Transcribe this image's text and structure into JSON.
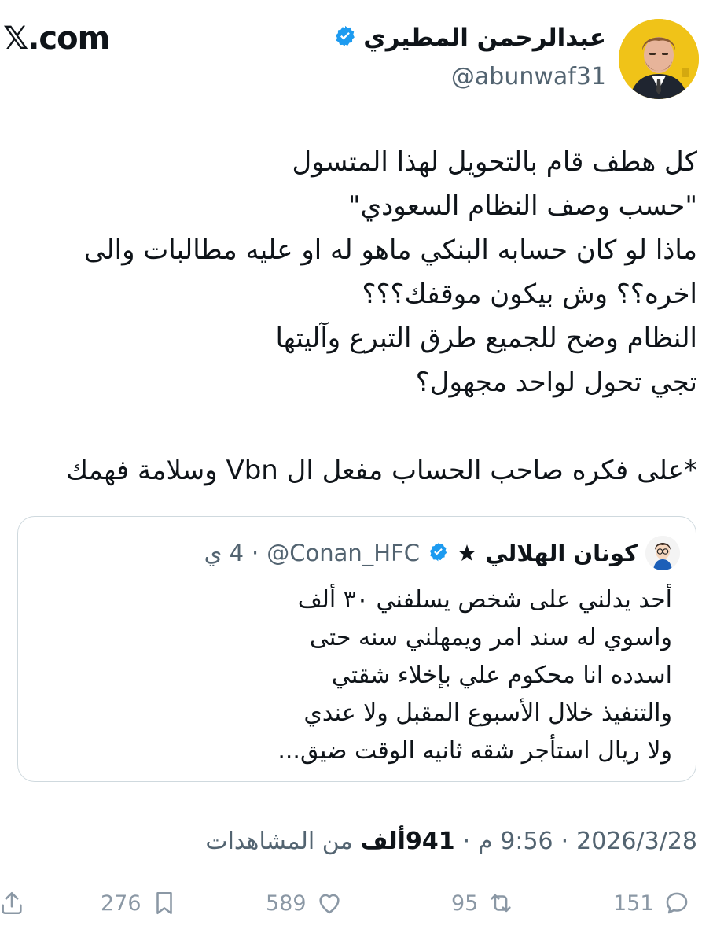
{
  "header": {
    "site_logo": "𝕏.com",
    "display_name": "عبدالرحمن المطيري",
    "handle": "@abunwaf31",
    "verified": true,
    "avatar_icon": "profile-photo"
  },
  "tweet": {
    "lines": [
      "كل هطف قام بالتحويل لهذا المتسول",
      "\"حسب وصف النظام السعودي\"",
      "ماذا لو كان حسابه البنكي ماهو له او عليه مطالبات والى",
      "اخره؟؟ وش بيكون موقفك؟؟؟",
      "النظام وضح للجميع طرق التبرع وآليتها",
      "تجي تحول لواحد مجهول؟",
      "",
      "*على فكره صاحب الحساب مفعل ال Vbn وسلامة فهمك"
    ]
  },
  "quote": {
    "display_name": "كونان الهلالي ★",
    "handle": "@Conan_HFC",
    "separator": "·",
    "time": "4 ي",
    "verified": true,
    "lines": [
      "أحد يدلني على شخص يسلفني ٣٠ ألف",
      "واسوي له سند امر ويمهلني سنه حتى",
      "اسدده انا محكوم علي بإخلاء شقتي",
      "والتنفيذ خلال الأسبوع المقبل ولا عندي",
      "ولا ريال استأجر شقه ثانيه الوقت ضيق..."
    ]
  },
  "meta": {
    "date": "2026/3/28",
    "sep1": "·",
    "time": "9:56 م",
    "sep2": "·",
    "views_count": "941",
    "views_unit": "ألف",
    "views_label": "من المشاهدات"
  },
  "actions": {
    "replies": "151",
    "reposts": "95",
    "likes": "589",
    "bookmarks": "276"
  },
  "colors": {
    "verified": "#1d9bf0",
    "secondary_text": "#536471",
    "action_icons": "#8b98a5",
    "border": "#cfd9de"
  }
}
